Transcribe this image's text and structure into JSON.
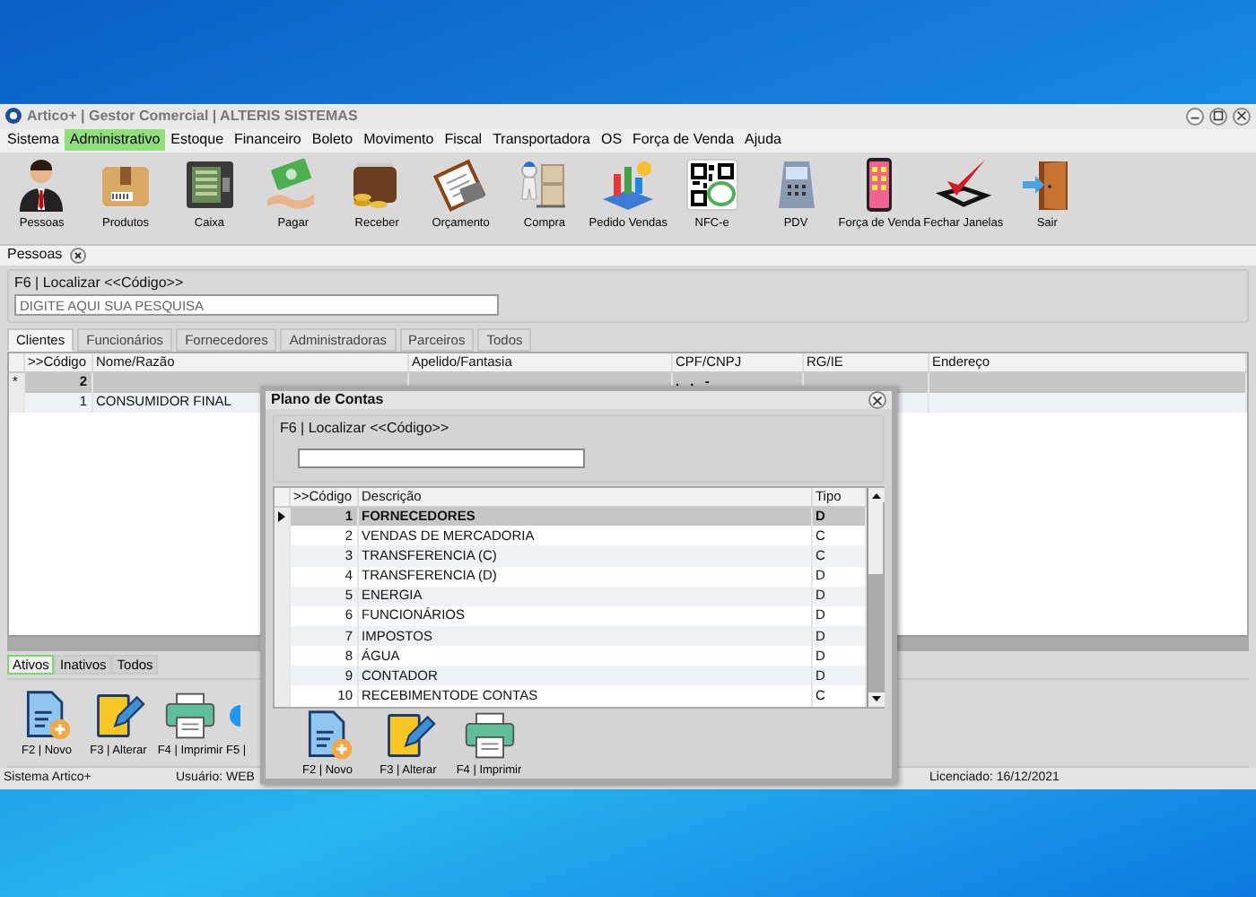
{
  "window": {
    "title": "Artico+ | Gestor Comercial | ALTERIS SISTEMAS"
  },
  "menu": [
    {
      "label": "Sistema",
      "selected": false
    },
    {
      "label": "Administrativo",
      "selected": true
    },
    {
      "label": "Estoque",
      "selected": false
    },
    {
      "label": "Financeiro",
      "selected": false
    },
    {
      "label": "Boleto",
      "selected": false
    },
    {
      "label": "Movimento",
      "selected": false
    },
    {
      "label": "Fiscal",
      "selected": false
    },
    {
      "label": "Transportadora",
      "selected": false
    },
    {
      "label": "OS",
      "selected": false
    },
    {
      "label": "Força de Venda",
      "selected": false
    },
    {
      "label": "Ajuda",
      "selected": false
    }
  ],
  "toolbar": [
    {
      "label": "Pessoas",
      "kind": "person"
    },
    {
      "label": "Produtos",
      "kind": "box"
    },
    {
      "label": "Caixa",
      "kind": "safe"
    },
    {
      "label": "Pagar",
      "kind": "money"
    },
    {
      "label": "Receber",
      "kind": "wallet"
    },
    {
      "label": "Orçamento",
      "kind": "clipboard"
    },
    {
      "label": "Compra",
      "kind": "boxes"
    },
    {
      "label": "Pedido Vendas",
      "kind": "chart"
    },
    {
      "label": "NFC-e",
      "kind": "qr"
    },
    {
      "label": "PDV",
      "kind": "terminal"
    },
    {
      "label": "Força de Venda",
      "kind": "phone"
    },
    {
      "label": "Fechar Janelas",
      "kind": "check"
    },
    {
      "label": "Sair",
      "kind": "door"
    }
  ],
  "document_tab": {
    "label": "Pessoas"
  },
  "search": {
    "legend": "F6 | Localizar <<Código>>",
    "placeholder": "DIGITE AQUI SUA PESQUISA"
  },
  "tabs": [
    {
      "label": "Clientes",
      "selected": true
    },
    {
      "label": "Funcionários",
      "selected": false
    },
    {
      "label": "Fornecedores",
      "selected": false
    },
    {
      "label": "Administradoras",
      "selected": false
    },
    {
      "label": "Parceiros",
      "selected": false
    },
    {
      "label": "Todos",
      "selected": false
    }
  ],
  "grid": {
    "columns": [
      ">>Código",
      "Nome/Razão",
      "Apelido/Fantasia",
      "CPF/CNPJ",
      "RG/IE",
      "Endereço"
    ],
    "rows": [
      {
        "selected": true,
        "marker": "*",
        "code": "2",
        "cpf_cnpj": ". . -"
      },
      {
        "selected": false,
        "code": "1",
        "name": "CONSUMIDOR FINAL"
      }
    ]
  },
  "status_tabs": [
    {
      "label": "Ativos",
      "selected": true
    },
    {
      "label": "Inativos",
      "selected": false
    },
    {
      "label": "Todos",
      "selected": false
    }
  ],
  "actions": [
    {
      "label": "F2 | Novo",
      "kind": "new"
    },
    {
      "label": "F3 | Alterar",
      "kind": "edit"
    },
    {
      "label": "F4 | Imprimir",
      "kind": "print"
    },
    {
      "label": "F5 |",
      "kind": "circle"
    }
  ],
  "status_bar": [
    "Sistema Artico+",
    "Usuário: WEB",
    "Licenciado: 16/12/2021"
  ],
  "dialog": {
    "title": "Plano de Contas",
    "legend": "F6 | Localizar <<Código>>",
    "columns": [
      ">>Código",
      "Descrição",
      "Tipo"
    ],
    "rows": [
      {
        "code": "1",
        "description": "FORNECEDORES",
        "type": "D",
        "selected": true
      },
      {
        "code": "2",
        "description": "VENDAS DE MERCADORIA",
        "type": "C",
        "selected": false
      },
      {
        "code": "3",
        "description": "TRANSFERENCIA (C)",
        "type": "C",
        "selected": false
      },
      {
        "code": "4",
        "description": "TRANSFERENCIA (D)",
        "type": "D",
        "selected": false
      },
      {
        "code": "5",
        "description": "ENERGIA",
        "type": "D",
        "selected": false
      },
      {
        "code": "6",
        "description": "FUNCIONÁRIOS",
        "type": "D",
        "selected": false
      },
      {
        "code": "7",
        "description": "IMPOSTOS",
        "type": "D",
        "selected": false
      },
      {
        "code": "8",
        "description": "ÁGUA",
        "type": "D",
        "selected": false
      },
      {
        "code": "9",
        "description": "CONTADOR",
        "type": "D",
        "selected": false
      },
      {
        "code": "10",
        "description": "RECEBIMENTODE CONTAS",
        "type": "C",
        "selected": false
      }
    ],
    "actions": [
      {
        "label": "F2 | Novo",
        "kind": "new"
      },
      {
        "label": "F3 | Alterar",
        "kind": "edit"
      },
      {
        "label": "F4 | Imprimir",
        "kind": "print"
      }
    ]
  }
}
